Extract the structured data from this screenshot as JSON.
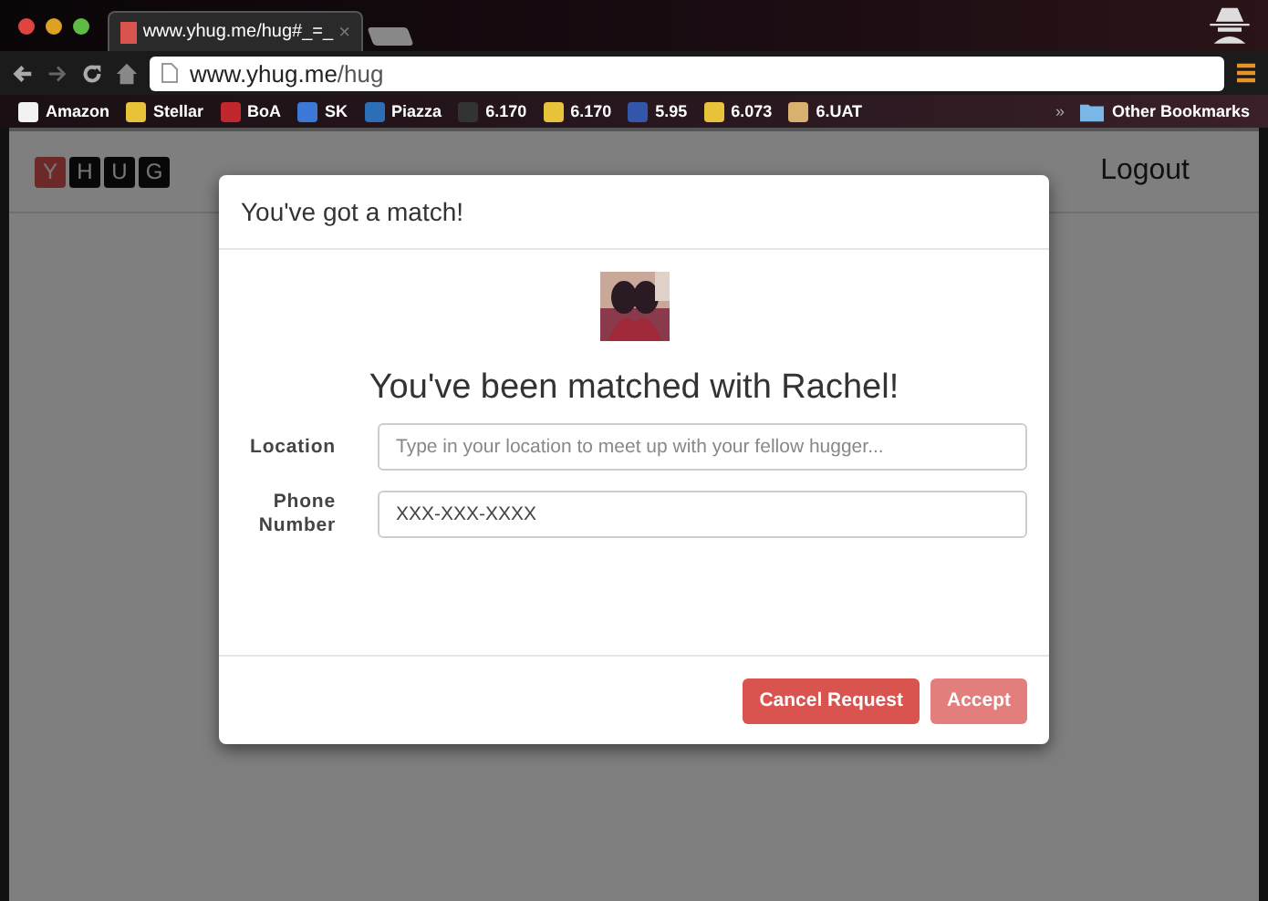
{
  "browser": {
    "tab": {
      "title": "www.yhug.me/hug#_=_",
      "close": "×"
    },
    "address": {
      "host": "www.yhug.me",
      "path": "/hug"
    },
    "bookmarks": [
      {
        "label": "Amazon"
      },
      {
        "label": "Stellar"
      },
      {
        "label": "BoA"
      },
      {
        "label": "SK"
      },
      {
        "label": "Piazza"
      },
      {
        "label": "6.170"
      },
      {
        "label": "6.170"
      },
      {
        "label": "5.95"
      },
      {
        "label": "6.073"
      },
      {
        "label": "6.UAT"
      }
    ],
    "overflow": "»",
    "other_bookmarks": "Other Bookmarks"
  },
  "navbar": {
    "logo": [
      "Y",
      "H",
      "U",
      "G"
    ],
    "logout": "Logout"
  },
  "modal": {
    "title": "You've got a match!",
    "heading": "You've been matched with Rachel!",
    "fields": [
      {
        "label": "Location",
        "placeholder": "Type in your location to meet up with your fellow hugger..."
      },
      {
        "label": "Phone Number",
        "value": "XXX-XXX-XXXX"
      }
    ],
    "buttons": [
      {
        "label": "Cancel Request",
        "kind": "danger",
        "disabled": false
      },
      {
        "label": "Accept",
        "kind": "danger",
        "disabled": true
      }
    ]
  }
}
